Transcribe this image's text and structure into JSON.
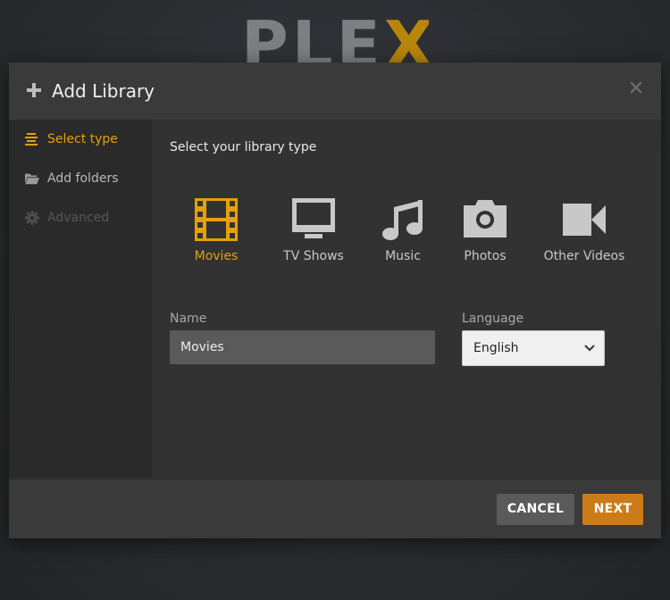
{
  "background": {
    "logo_main": "PLE",
    "logo_x": "X"
  },
  "dialog": {
    "title": "Add Library",
    "header_icon": "plus-icon",
    "close_icon": "close-icon"
  },
  "sidebar": {
    "items": [
      {
        "label": "Select type",
        "icon": "list-icon",
        "state": "active"
      },
      {
        "label": "Add folders",
        "icon": "folder-icon",
        "state": "normal"
      },
      {
        "label": "Advanced",
        "icon": "gear-icon",
        "state": "disabled"
      }
    ]
  },
  "main": {
    "section_title": "Select your library type",
    "library_types": [
      {
        "label": "Movies",
        "icon": "film-icon",
        "selected": true
      },
      {
        "label": "TV Shows",
        "icon": "tv-icon",
        "selected": false
      },
      {
        "label": "Music",
        "icon": "music-note-icon",
        "selected": false
      },
      {
        "label": "Photos",
        "icon": "camera-icon",
        "selected": false
      },
      {
        "label": "Other Videos",
        "icon": "video-camera-icon",
        "selected": false
      }
    ],
    "name_label": "Name",
    "name_value": "Movies",
    "language_label": "Language",
    "language_value": "English"
  },
  "footer": {
    "cancel_label": "CANCEL",
    "next_label": "NEXT"
  },
  "colors": {
    "accent": "#e5a00d",
    "next_button": "#cc7b19",
    "cancel_button": "#5a5a5a",
    "dialog_bg": "#323232",
    "sidebar_bg": "#2a2a2a"
  }
}
